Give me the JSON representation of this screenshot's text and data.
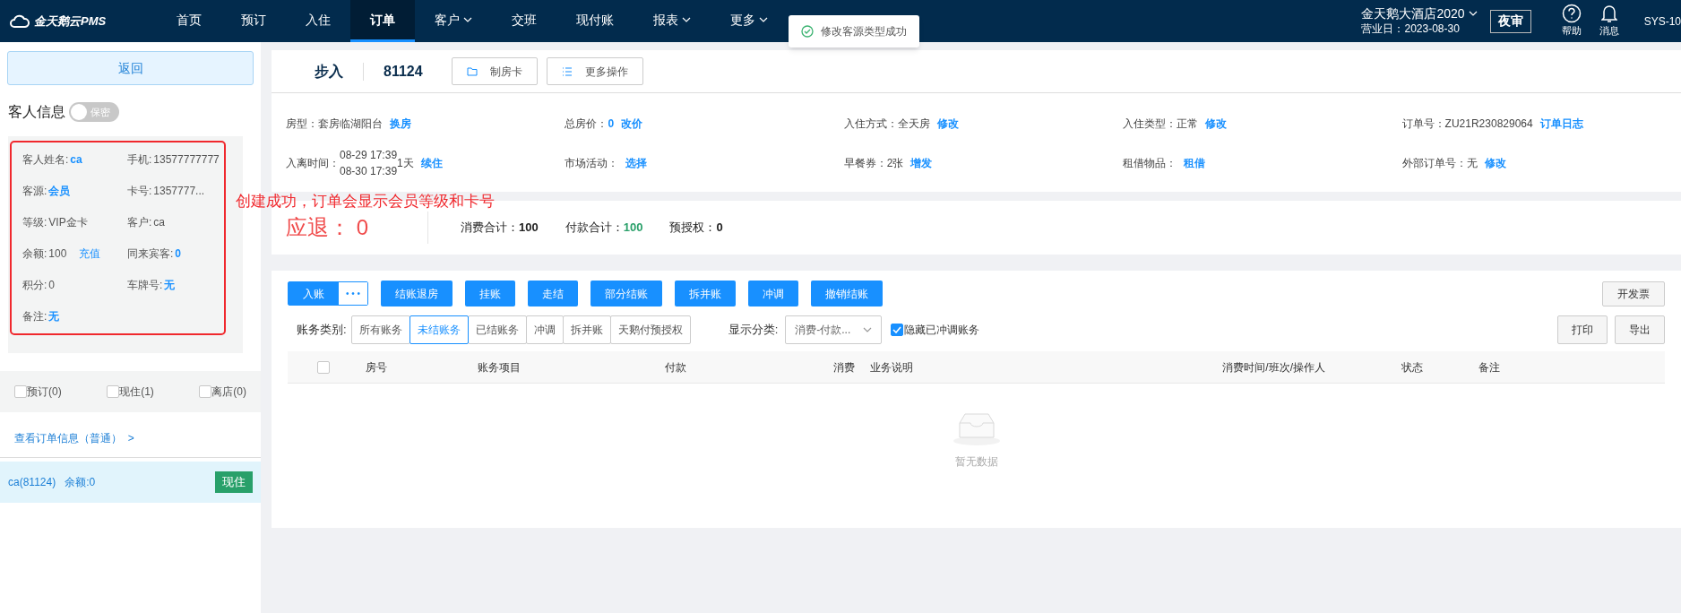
{
  "topbar": {
    "logo": "金天鹅云PMS",
    "nav": [
      {
        "label": "首页",
        "selected": false,
        "dropdown": false
      },
      {
        "label": "预订",
        "selected": false,
        "dropdown": false
      },
      {
        "label": "入住",
        "selected": false,
        "dropdown": false
      },
      {
        "label": "订单",
        "selected": true,
        "dropdown": false
      },
      {
        "label": "客户",
        "selected": false,
        "dropdown": true
      },
      {
        "label": "交班",
        "selected": false,
        "dropdown": false
      },
      {
        "label": "现付账",
        "selected": false,
        "dropdown": false
      },
      {
        "label": "报表",
        "selected": false,
        "dropdown": true
      },
      {
        "label": "更多",
        "selected": false,
        "dropdown": true
      }
    ],
    "hotel": "金天鹅大酒店2020",
    "business_day": "营业日：2023-08-30",
    "night_audit": "夜审",
    "help": "帮助",
    "messages": "消息",
    "user": "SYS-10"
  },
  "toast": "修改客源类型成功",
  "sidebar": {
    "back": "返回",
    "guest_title": "客人信息",
    "secret_toggle": {
      "label": "保密",
      "on": false
    },
    "guest_info": [
      {
        "label": "客人姓名: ",
        "value": "ca",
        "link": true
      },
      {
        "label": "手机: ",
        "value": "13577777777",
        "link": false
      },
      {
        "label": "客源: ",
        "value": "会员",
        "link": true
      },
      {
        "label": "卡号: ",
        "value": "1357777...",
        "link": false
      },
      {
        "label": "等级: ",
        "value": "VIP金卡",
        "link": false
      },
      {
        "label": "客户: ",
        "value": "ca",
        "link": false
      },
      {
        "label": "余额: ",
        "value": "100",
        "link": false,
        "action": "充值"
      },
      {
        "label": "同来宾客: ",
        "value": "0",
        "link": true
      },
      {
        "label": "积分: ",
        "value": "0",
        "link": false
      },
      {
        "label": "车牌号: ",
        "value": "无",
        "link": true
      },
      {
        "label": "备注: ",
        "value": "无",
        "link": true
      }
    ],
    "filters": [
      {
        "label": "预订(0)",
        "checked": false
      },
      {
        "label": "现住(1)",
        "checked": false
      },
      {
        "label": "离店(0)",
        "checked": false
      }
    ],
    "order_link": "查看订单信息（普通）  >",
    "rooms": [
      {
        "name": "ca(81124)",
        "balance": "余额:0",
        "status": "现住",
        "selected": true
      }
    ]
  },
  "annotation": "创建成功，订单会显示会员等级和卡号",
  "order": {
    "type": "步入",
    "room": "81124",
    "actions": [
      "制房卡",
      "更多操作"
    ],
    "fields": [
      {
        "label": "房型：",
        "value": "套房临湖阳台",
        "action": "换房"
      },
      {
        "label": "总房价：",
        "value": "0",
        "value_link": true,
        "action": "改价"
      },
      {
        "label": "入住方式：",
        "value": "全天房",
        "action": "修改"
      },
      {
        "label": "入住类型：",
        "value": "正常",
        "action": "修改"
      },
      {
        "label": "订单号：",
        "value": "ZU21R230829064",
        "action": "订单日志"
      },
      {
        "label": "入离时间：",
        "dates": [
          "08-29 17:39",
          "08-30 17:39"
        ],
        "value": "1天",
        "action": "续住"
      },
      {
        "label": "市场活动：",
        "action": "选择"
      },
      {
        "label": "早餐券：",
        "value": "2张",
        "action": "增发"
      },
      {
        "label": "租借物品：",
        "action": "租借"
      },
      {
        "label": "外部订单号：",
        "value": "无",
        "action": "修改"
      }
    ]
  },
  "totals": {
    "refund": "应退： 0",
    "items": [
      {
        "label": "消费合计：",
        "value": "100",
        "kind": "plain"
      },
      {
        "label": "付款合计：",
        "value": "100",
        "kind": "positive"
      },
      {
        "label": "预授权：",
        "value": "0",
        "kind": "plain"
      }
    ]
  },
  "bills": {
    "post": "入账",
    "more": "• • •",
    "actions": [
      "结账退房",
      "挂账",
      "走结",
      "部分结账",
      "拆并账",
      "冲调",
      "撤销结账"
    ],
    "invoice": "开发票",
    "category_label": "账务类别:",
    "categories": [
      {
        "label": "所有账务",
        "selected": false
      },
      {
        "label": "未结账务",
        "selected": true
      },
      {
        "label": "已结账务",
        "selected": false
      },
      {
        "label": "冲调",
        "selected": false
      },
      {
        "label": "拆并账",
        "selected": false
      },
      {
        "label": "天鹅付预授权",
        "selected": false
      }
    ],
    "display_label": "显示分类:",
    "display_value": "消费-付款...",
    "hide_adjusted": {
      "label": "隐藏已冲调账务",
      "checked": true
    },
    "print": "打印",
    "export": "导出",
    "select_all_checked": false,
    "columns": [
      "房号",
      "账务项目",
      "付款",
      "消费",
      "业务说明",
      "消费时间/班次/操作人",
      "状态",
      "备注"
    ],
    "empty": "暂无数据"
  }
}
